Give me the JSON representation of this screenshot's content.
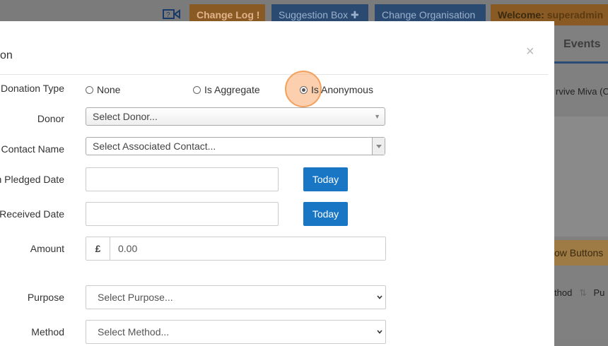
{
  "topbar": {
    "change_log": "Change Log !",
    "suggestion_box": "Suggestion Box ✚",
    "change_org": "Change Organisation",
    "welcome_prefix": "Welcome:",
    "welcome_user": "superadmin"
  },
  "background": {
    "events_tab": "Events",
    "row_text": "rvive Miva (C",
    "show_buttons": "ow Buttons",
    "col_method": "thod",
    "col_next": "Pu"
  },
  "modal": {
    "title": "on",
    "close_glyph": "×",
    "donation_type_label": "Donation Type",
    "radios": [
      {
        "label": "None",
        "checked": false
      },
      {
        "label": "Is Aggregate",
        "checked": false
      },
      {
        "label": "Is Anonymous",
        "checked": true
      }
    ],
    "donor_label": "Donor",
    "donor_placeholder": "Select Donor...",
    "contact_label": "Contact Name",
    "contact_placeholder": "Select Associated Contact...",
    "pledged_label": "n Pledged Date",
    "received_label": "Received Date",
    "today_label": "Today",
    "amount_label": "Amount",
    "currency": "£",
    "amount_value": "0.00",
    "purpose_label": "Purpose",
    "purpose_placeholder": "Select Purpose...",
    "method_label": "Method",
    "method_placeholder": "Select Method..."
  },
  "colors": {
    "primary": "#1976c5",
    "highlight": "#f3a15e"
  }
}
